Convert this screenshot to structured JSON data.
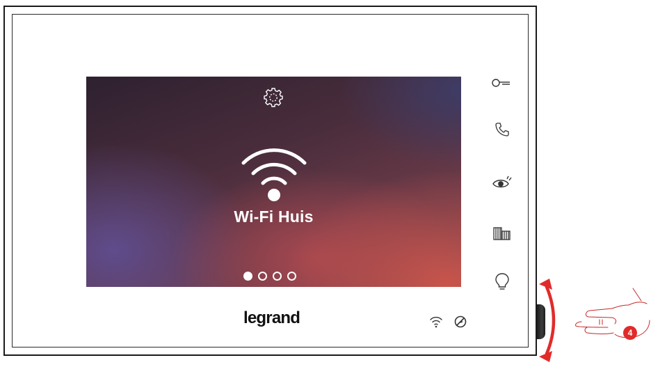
{
  "screen": {
    "network_name": "Wi-Fi Huis",
    "page_count": 4,
    "active_page": 1
  },
  "side_buttons": [
    {
      "icon": "key-icon"
    },
    {
      "icon": "phone-icon"
    },
    {
      "icon": "eye-icon"
    },
    {
      "icon": "gate-icon"
    },
    {
      "icon": "bulb-icon"
    }
  ],
  "brand": "legrand",
  "status_icons": [
    "wifi-status-icon",
    "do-not-disturb-icon"
  ],
  "instruction": {
    "step": "4"
  },
  "colors": {
    "accent": "#e12b2b",
    "frame": "#1a1a1a",
    "screen_text": "#ffffff"
  }
}
